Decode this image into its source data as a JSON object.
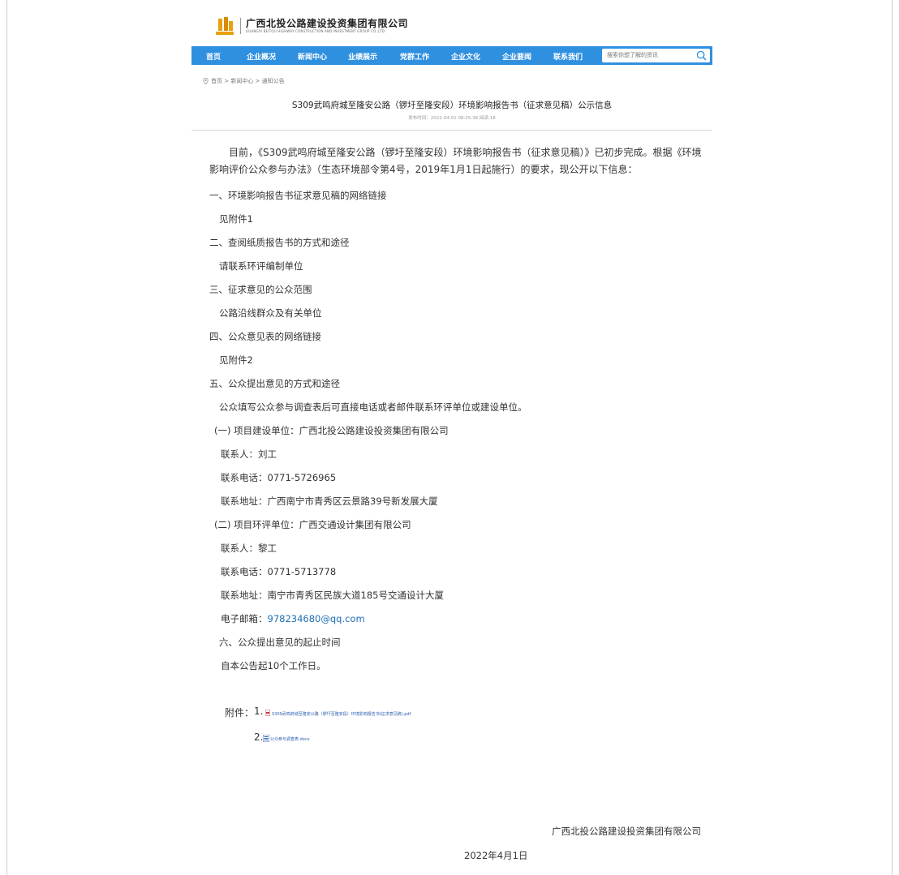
{
  "header": {
    "logo_cn": "广西北投公路建设投资集团有限公司",
    "logo_en": "GUANGXI BEITOU HIGHWAY CONSTRUCTION AND INVESTMENT GROUP CO.,LTD."
  },
  "nav": {
    "items": [
      "首页",
      "企业概况",
      "新闻中心",
      "业绩展示",
      "党群工作",
      "企业文化",
      "企业要闻",
      "联系我们"
    ],
    "search_placeholder": "搜索你想了解的资讯",
    "bg_color": "#2f90e0"
  },
  "breadcrumb": "首页 > 新闻中心 > 通知公告",
  "article": {
    "title": "S309武鸣府城至隆安公路（锣圩至隆安段）环境影响报告书（征求意见稿）公示信息",
    "meta": "发布时间：2022-04-01 08:25:38 阅读:18",
    "intro": "目前，《S309武鸣府城至隆安公路（锣圩至隆安段）环境影响报告书（征求意见稿）》已初步完成。根据《环境影响评价公众参与办法》（生态环境部令第4号，2019年1月1日起施行）的要求，现公开以下信息：",
    "lines": [
      "一、环境影响报告书征求意见稿的网络链接",
      "见附件1",
      "二、查阅纸质报告书的方式和途径",
      "请联系环评编制单位",
      "三、征求意见的公众范围",
      "公路沿线群众及有关单位",
      "四、公众意见表的网络链接",
      "见附件2",
      "五、公众提出意见的方式和途径",
      "公众填写公众参与调查表后可直接电话或者邮件联系环评单位或建设单位。",
      "(一) 项目建设单位：广西北投公路建设投资集团有限公司",
      "联系人：刘工",
      "联系电话：0771-5726965",
      "联系地址：广西南宁市青秀区云景路39号新发展大厦",
      "(二) 项目环评单位：广西交通设计集团有限公司",
      "联系人：黎工",
      "联系电话：0771-5713778",
      "联系地址：南宁市青秀区民族大道185号交通设计大厦"
    ],
    "email_label": "电子邮箱：",
    "email": "978234680@qq.com",
    "line_6": "六、公众提出意见的起止时间",
    "line_6_detail": "自本公告起10个工作日。",
    "attachments_label": "附件：",
    "attachments": [
      {
        "num": "1.",
        "name": "S309武鸣府城至隆安公路（锣圩至隆安段）环境影响报告书(征求意见稿).pdf",
        "icon": "pdf-icon"
      },
      {
        "num": "2.",
        "name": "公众参与调查表.docx",
        "icon": "doc-icon"
      }
    ],
    "sign_org": "广西北投公路建设投资集团有限公司",
    "sign_date": "2022年4月1日"
  },
  "colors": {
    "accent": "#2f90e0",
    "link": "#1f6fb3",
    "logo": "#e8a10e"
  }
}
